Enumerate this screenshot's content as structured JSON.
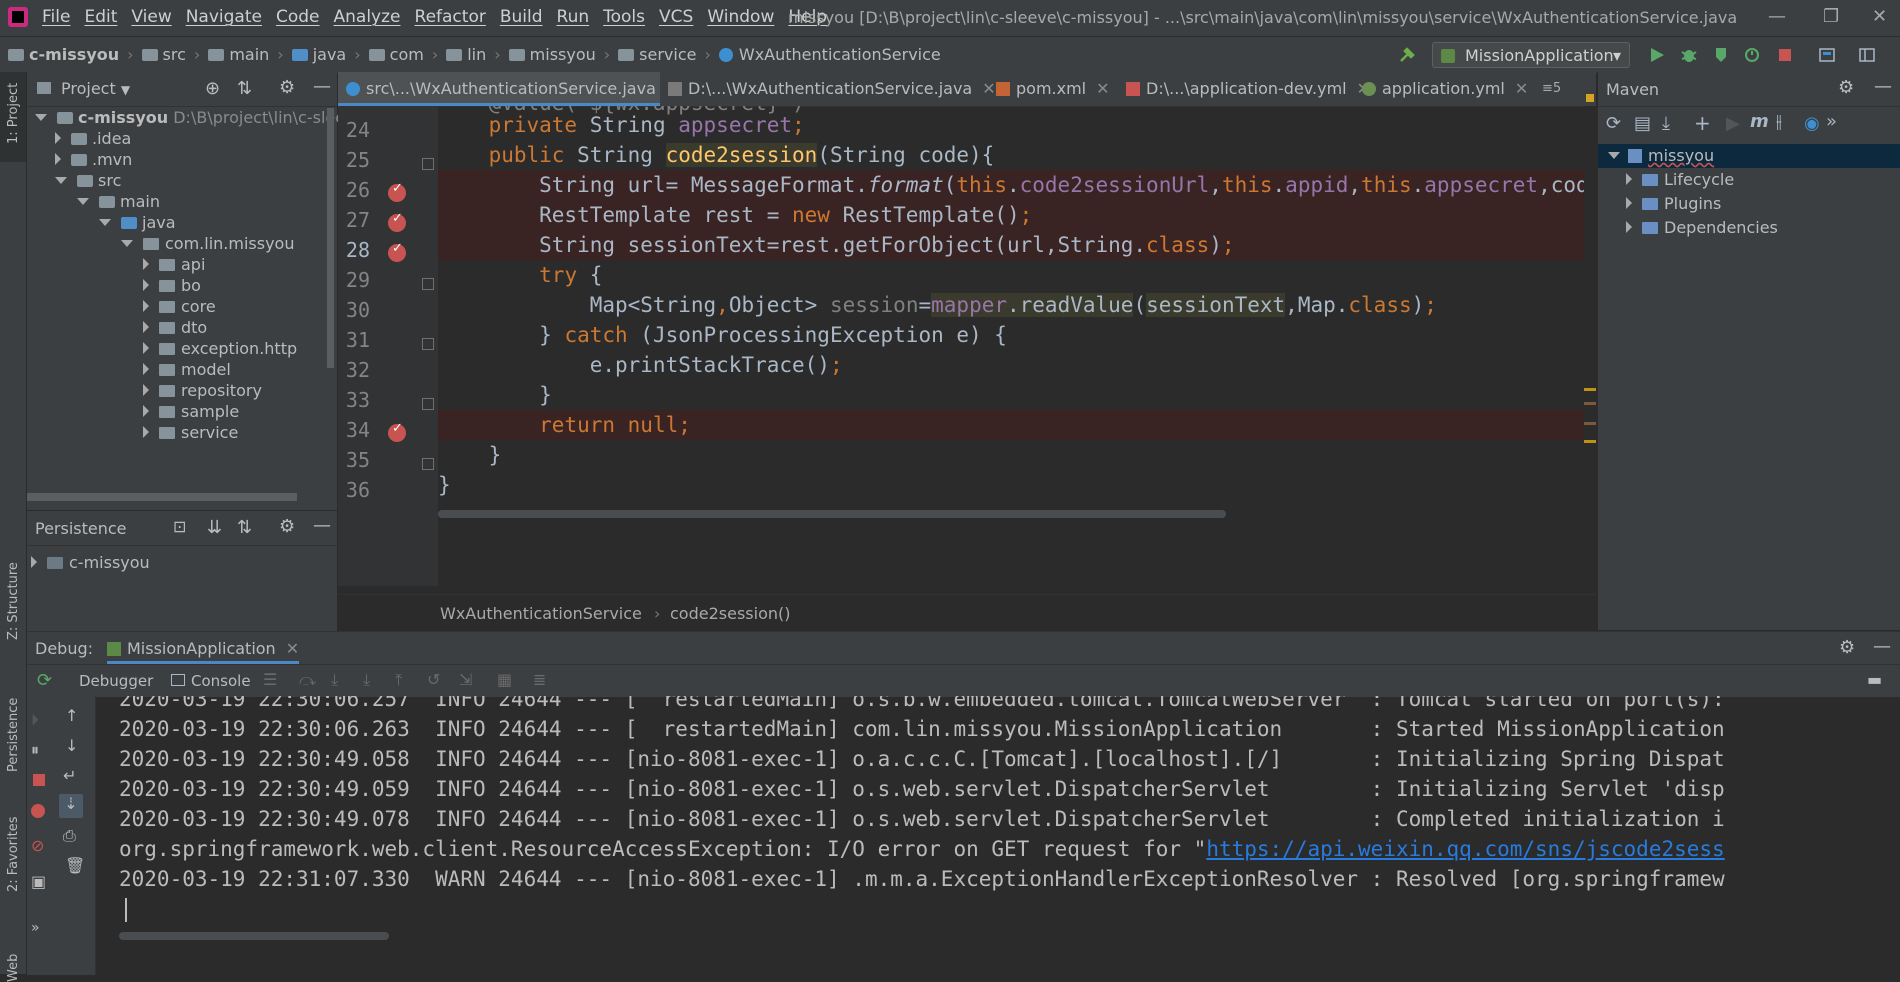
{
  "menubar": {
    "items": [
      "File",
      "Edit",
      "View",
      "Navigate",
      "Code",
      "Analyze",
      "Refactor",
      "Build",
      "Run",
      "Tools",
      "VCS",
      "Window",
      "Help"
    ],
    "window_title": "missyou [D:\\B\\project\\lin\\c-sleeve\\c-missyou] - ...\\src\\main\\java\\com\\lin\\missyou\\service\\WxAuthenticationService.java"
  },
  "navbar": {
    "crumbs": [
      "c-missyou",
      "src",
      "main",
      "java",
      "com",
      "lin",
      "missyou",
      "service",
      "WxAuthenticationService"
    ],
    "run_config": "MissionApplication"
  },
  "left_stripe": {
    "project": "1: Project",
    "structure": "Z: Structure",
    "persistence": "Persistence",
    "favorites": "2: Favorites",
    "web": "Web"
  },
  "project": {
    "header": "Project",
    "tree": [
      {
        "label": "c-missyou",
        "extra": "D:\\B\\project\\lin\\c-sleeve"
      },
      {
        "label": ".idea"
      },
      {
        "label": ".mvn"
      },
      {
        "label": "src"
      },
      {
        "label": "main"
      },
      {
        "label": "java"
      },
      {
        "label": "com.lin.missyou"
      },
      {
        "label": "api"
      },
      {
        "label": "bo"
      },
      {
        "label": "core"
      },
      {
        "label": "dto"
      },
      {
        "label": "exception.http"
      },
      {
        "label": "model"
      },
      {
        "label": "repository"
      },
      {
        "label": "sample"
      },
      {
        "label": "service"
      }
    ]
  },
  "persistence": {
    "header": "Persistence",
    "item": "c-missyou"
  },
  "editor": {
    "tabs": [
      {
        "label": "src\\...\\WxAuthenticationService.java"
      },
      {
        "label": "D:\\...\\WxAuthenticationService.java"
      },
      {
        "label": "pom.xml"
      },
      {
        "label": "D:\\...\\application-dev.yml"
      },
      {
        "label": "application.yml"
      }
    ],
    "tab_overflow": "5",
    "line_numbers": [
      "24",
      "25",
      "26",
      "27",
      "28",
      "29",
      "30",
      "31",
      "32",
      "33",
      "34",
      "35",
      "36"
    ],
    "breadcrumb": [
      "WxAuthenticationService",
      "code2session()"
    ]
  },
  "maven": {
    "header": "Maven",
    "root": "missyou",
    "children": [
      "Lifecycle",
      "Plugins",
      "Dependencies"
    ]
  },
  "debug": {
    "label": "Debug:",
    "tab": "MissionApplication",
    "debugger_tab": "Debugger",
    "console_tab": "Console",
    "console_lines": [
      "2020-03-19 22:30:06.257  INFO 24644 --- [  restartedMain] o.s.b.w.embedded.tomcat.TomcatWebServer  : Tomcat started on port(s):",
      "2020-03-19 22:30:06.263  INFO 24644 --- [  restartedMain] com.lin.missyou.MissionApplication       : Started MissionApplication",
      "2020-03-19 22:30:49.058  INFO 24644 --- [nio-8081-exec-1] o.a.c.c.C.[Tomcat].[localhost].[/]       : Initializing Spring Dispat",
      "2020-03-19 22:30:49.059  INFO 24644 --- [nio-8081-exec-1] o.s.web.servlet.DispatcherServlet        : Initializing Servlet 'disp",
      "2020-03-19 22:30:49.078  INFO 24644 --- [nio-8081-exec-1] o.s.web.servlet.DispatcherServlet        : Completed initialization i"
    ],
    "exception_prefix": "org.springframework.web.client.ResourceAccessException: I/O error on GET request for \"",
    "exception_link": "https://api.weixin.qq.com/sns/jscode2sess",
    "warn_line": "2020-03-19 22:31:07.330  WARN 24644 --- [nio-8081-exec-1] .m.m.a.ExceptionHandlerExceptionResolver : Resolved [org.springframew"
  }
}
